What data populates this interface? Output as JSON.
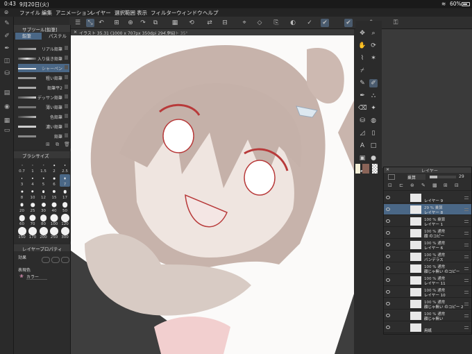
{
  "statusbar": {
    "time": "0:43",
    "date": "9月20日(火)",
    "battery": "60%"
  },
  "menubar": {
    "items": [
      "ファイル",
      "編集",
      "アニメーション",
      "レイヤー",
      "選択範囲",
      "表示",
      "フィルター",
      "ウィンドウ",
      "ヘルプ"
    ]
  },
  "canvas_tabs": {
    "active": "イラスト 35.31 (1000 x 707px 350dpi 294.9%)",
    "second": "イラスト 35°"
  },
  "subtool": {
    "title": "サブツール[鉛筆]",
    "tabs": [
      "鉛筆",
      "パステル"
    ],
    "brushes": [
      "リアル鉛筆",
      "入り抜き鉛筆",
      "シャーペン",
      "粗い鉛筆",
      "鉛筆平2",
      "デッサン鉛筆",
      "薄い鉛筆",
      "色鉛筆",
      "濃い鉛筆",
      "鉛筆"
    ],
    "selected_index": 2
  },
  "brushsize": {
    "title": "ブラシサイズ",
    "sizes": [
      "0.7",
      "1",
      "1.5",
      "2",
      "2.5",
      "3",
      "4",
      "5",
      "6",
      "7",
      "8",
      "10",
      "12",
      "15",
      "17",
      "20",
      "25",
      "30",
      "40",
      "50",
      "60",
      "70",
      "80",
      "100",
      "120",
      "150",
      "170",
      "200",
      "250",
      "300"
    ],
    "selected": "7"
  },
  "layerprop": {
    "title": "レイヤープロパティ",
    "effect_label": "効果",
    "color_label": "表現色",
    "color_value": "カラー"
  },
  "layerpanel": {
    "title": "レイヤー",
    "blend": "乗算",
    "opacity": "29",
    "layers": [
      {
        "l1": "",
        "l2": "レイヤー 9"
      },
      {
        "l1": "29 % 乗算",
        "l2": "レイヤー 8"
      },
      {
        "l1": "100 % 乗算",
        "l2": "レイヤー 1"
      },
      {
        "l1": "100 % 通常",
        "l2": "顔 のコピー"
      },
      {
        "l1": "100 % 通常",
        "l2": "レイヤー 6"
      },
      {
        "l1": "100 % 通常",
        "l2": "バンデラス"
      },
      {
        "l1": "100 % 通常",
        "l2": "顔じゃ無い のコピー"
      },
      {
        "l1": "100 % 通常",
        "l2": "レイヤー 11"
      },
      {
        "l1": "100 % 通常",
        "l2": "レイヤー 10"
      },
      {
        "l1": "100 % 通常",
        "l2": "顔じゃ無い のコピー 2"
      },
      {
        "l1": "100 % 通常",
        "l2": "顔じゃ無い"
      },
      {
        "l1": "",
        "l2": "用紙"
      }
    ],
    "selected_index": 1
  },
  "colors": {
    "accent": "#4a6786",
    "line_red": "#b83a3a",
    "skin": "#e9dcd6",
    "hair": "#c8b3aa"
  }
}
